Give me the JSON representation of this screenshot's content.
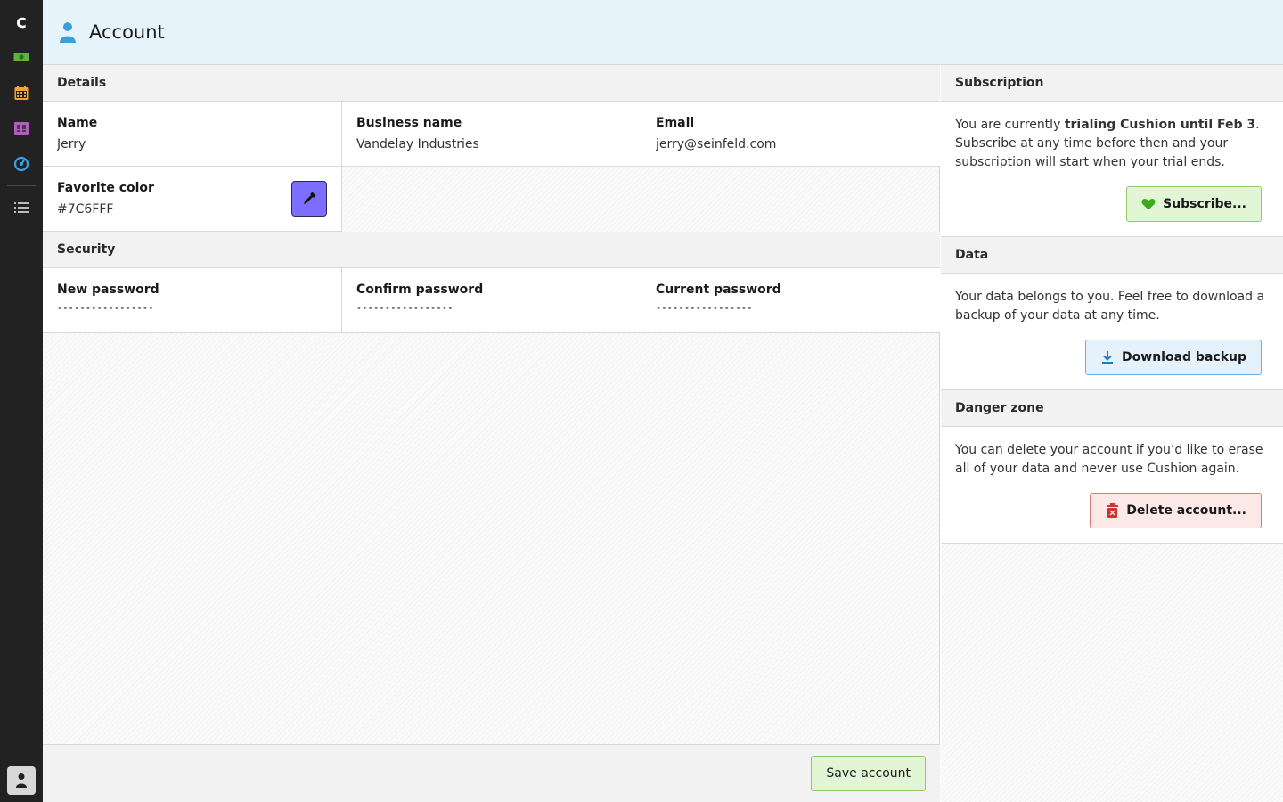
{
  "app": {
    "logo_letter": "c"
  },
  "sidebar": {
    "items": [
      {
        "name": "money-icon",
        "color": "#5fb33a"
      },
      {
        "name": "calendar-icon",
        "color": "#f2a33a"
      },
      {
        "name": "ledger-icon",
        "color": "#b05fbf"
      },
      {
        "name": "clock-icon",
        "color": "#3a9fdc"
      },
      {
        "name": "list-icon",
        "color": "#bbbbbb"
      }
    ]
  },
  "header": {
    "title": "Account",
    "icon": "user-icon",
    "icon_color": "#3a9fdc"
  },
  "details": {
    "title": "Details",
    "name_label": "Name",
    "name_value": "Jerry",
    "business_label": "Business name",
    "business_value": "Vandelay Industries",
    "email_label": "Email",
    "email_value": "jerry@seinfeld.com",
    "color_label": "Favorite color",
    "color_value": "#7C6FFF"
  },
  "security": {
    "title": "Security",
    "new_label": "New password",
    "new_value": "•••••••••••••••••",
    "confirm_label": "Confirm password",
    "confirm_value": "•••••••••••••••••",
    "current_label": "Current password",
    "current_value": "•••••••••••••••••"
  },
  "footer": {
    "save_label": "Save account"
  },
  "subscription": {
    "title": "Subscription",
    "text_pre": "You are currently ",
    "text_bold": "trialing Cushion until Feb 3",
    "text_post": ". Subscribe at any time before then and your subscription will start when your trial ends.",
    "button_label": "Subscribe..."
  },
  "data": {
    "title": "Data",
    "text": "Your data belongs to you. Feel free to download a backup of your data at any time.",
    "button_label": "Download backup"
  },
  "danger": {
    "title": "Danger zone",
    "text": "You can delete your account if you’d like to erase all of your data and never use Cushion again.",
    "button_label": "Delete account..."
  },
  "colors": {
    "accent_green": "#5fb33a",
    "accent_blue": "#3a9fdc",
    "danger_red": "#d0312d"
  }
}
